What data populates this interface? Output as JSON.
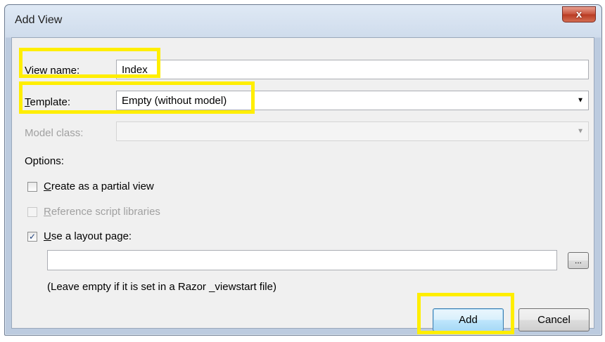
{
  "window": {
    "title": "Add View",
    "close_glyph": "x"
  },
  "form": {
    "view_name": {
      "label_pre": "View ",
      "label_accel": "n",
      "label_post": "ame:",
      "value": "Index"
    },
    "template": {
      "label_accel": "T",
      "label_post": "emplate:",
      "value": "Empty (without model)"
    },
    "model_class": {
      "label": "Model class:",
      "value": ""
    },
    "options_label": "Options:",
    "partial_view": {
      "label_accel": "C",
      "label_post": "reate as a partial view",
      "checked": false
    },
    "reference_scripts": {
      "label_accel": "R",
      "label_post": "eference script libraries",
      "checked": false,
      "enabled": false
    },
    "layout_page": {
      "label_accel": "U",
      "label_post": "se a layout page:",
      "checked": true,
      "check_glyph": "✓",
      "path_value": "",
      "browse_label": "..."
    },
    "hint": "(Leave empty if it is set in a Razor _viewstart file)"
  },
  "buttons": {
    "add": "Add",
    "cancel": "Cancel"
  },
  "colors": {
    "highlight": "#ffee00",
    "close_button": "#c7513a",
    "default_button_border": "#3c7fb1"
  },
  "icons": {
    "dropdown": "dropdown-arrow-icon",
    "close": "close-icon",
    "check": "checkmark-icon"
  }
}
